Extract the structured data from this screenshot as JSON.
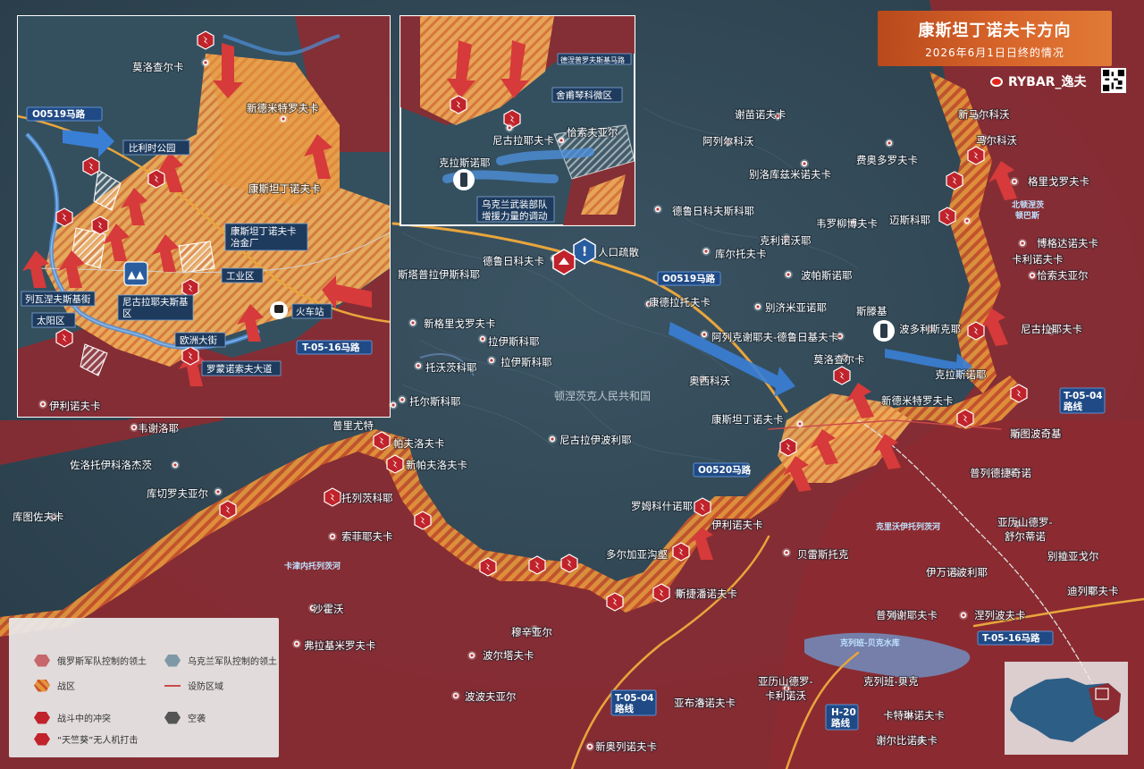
{
  "header": {
    "title": "康斯坦丁诺夫卡方向",
    "subtitle": "2026年6月1日日终的情况",
    "brand": "RYBAR_逸夫"
  },
  "colors": {
    "russian": "#8f2a30",
    "ukrainian": "#2f4f62",
    "combat_zone": "#e89a3a",
    "accent": "#d8652a",
    "road_label": "#1f4a86"
  },
  "legend": {
    "russian": "俄罗斯军队控制的领土",
    "ukrainian": "乌克兰军队控制的领土",
    "zone": "战区",
    "defense": "设防区域",
    "conflict": "战斗中的冲突",
    "airstrike": "空袭",
    "drone": "“天竺葵”无人机打击"
  },
  "inset_left": {
    "places": {
      "molochar": "莫洛查尔卡",
      "novodmitrovka": "新德米特罗夫卡",
      "bilytsk_park": "比利时公园",
      "konst": "康斯坦丁诺夫卡",
      "metallurgical": "康斯坦丁诺夫卡\n冶金厂",
      "industrial": "工业区",
      "leva": "列瓦涅夫斯基街",
      "nikolaev_district": "尼古拉耶夫斯基\n区",
      "sun": "太阳区",
      "europe_st": "欧洲大街",
      "rom": "罗蒙诺索夫大道",
      "station": "火车站",
      "ilinovka": "伊利诺夫卡"
    },
    "roads": {
      "o0519": "O0519马路",
      "t0516": "T-05-16马路"
    }
  },
  "inset_top": {
    "places": {
      "kramatorsk_plant": "德涅普罗夫斯基马路",
      "shevchenko": "舍甫琴科微区",
      "nikolaevka": "尼古拉耶夫卡",
      "chasov": "恰索夫亚尔",
      "kramat": "克拉斯诺耶",
      "reinforce": "乌克兰武装部队\n增援力量的调动"
    }
  },
  "main": {
    "places": {
      "stupochky": "斯塔普拉伊斯科耶",
      "dezh": "德鲁日科夫卡",
      "evac": "人口疏散",
      "o0519": "O0519马路",
      "konstrow": "康德拉托夫卡",
      "alek": "阿列克谢耶夫-德鲁日基夫卡",
      "oseva": "奥西科沃",
      "donbas": "顿涅茨克人民共和国",
      "konst": "康斯坦丁诺夫卡",
      "nikop": "尼古拉伊波利耶",
      "novgor": "新格里戈罗夫卡",
      "plas": "拉伊斯科耶",
      "tor": "托沃茨科耶",
      "torsk": "托尔斯科耶",
      "ksh": "拉伊斯科耶",
      "ivlev": "谢苗诺夫卡",
      "arch": "阿列尔科沃",
      "bel": "别洛库兹米诺夫卡",
      "fed": "费奥多罗夫卡",
      "druz": "德鲁日科夫斯科耶",
      "kras": "克利诺沃耶",
      "kurt": "库尔托夫卡",
      "vrub": "韦罗柳博夫卡",
      "pod": "波帕斯诺耶",
      "bili": "别济米亚诺耶",
      "stup": "斯滕基",
      "polis": "波多利斯克耶",
      "nikol": "尼古拉耶夫卡",
      "moloc": "莫洛查尔卡",
      "kram2": "克拉斯诺耶",
      "novdm": "新德米特罗夫卡",
      "minsk": "迈斯科耶",
      "novmar": "新马尔科沃",
      "mark": "马尔科沃",
      "gri": "格里戈罗夫卡",
      "don": "北顿涅茨\n顿巴斯",
      "bogo": "博格达诺夫卡",
      "kali": "卡利诺夫卡",
      "chas": "恰索夫亚尔",
      "t0504": "T-05-04\n路线",
      "stup2": "斯图波奇基",
      "prem": "普列德捷奇诺",
      "ale": "亚历山德罗-\n舒尔蒂诺",
      "bil": "别拉亚戈尔",
      "ivanop": "伊万诺波利耶",
      "diliev": "迪列耶夫卡",
      "pshel": "涅列波夫卡",
      "prib": "普列谢耶夫卡",
      "t0516": "T-05-16马路",
      "klh": "克列班-贝克水库",
      "kle": "克列班-贝克",
      "ale2": "亚历山德罗-\n卡利诺沃",
      "h20": "H-20\n路线",
      "kat": "卡特琳诺夫卡",
      "shch": "谢尔比诺夫卡",
      "belo": "贝雷斯托克",
      "step": "斯捷潘诺夫卡",
      "ilin": "伊利诺夫卡",
      "rom": "罗姆科什诺耶",
      "dol": "多尔加亚沟壑",
      "o0520": "O0520马路",
      "prib2": "普里尤特",
      "pav": "帕夫洛夫卡",
      "novpav": "新帕夫洛夫卡",
      "torl": "托列茨科耶",
      "sof": "索菲耶夫卡",
      "kurd": "库切罗夫亚尔",
      "kura": "库图佐夫卡",
      "zol": "佐洛托伊科洛杰茨",
      "vesh": "韦谢洛耶",
      "shakh": "沙霍沃",
      "vlad": "弗拉基米罗夫卡",
      "muss": "穆辛亚尔",
      "pol": "波尔塔夫卡",
      "pob": "波波夫亚尔",
      "alek3": "亚布洛诺夫卡",
      "novale": "新奥列诺夫卡",
      "t0504b": "T-05-04\n路线",
      "river1": "卡津内托列茨河",
      "river2": "克里沃伊托列茨河",
      "t0516b": "T-05-16马路",
      "t0504c": "T-05-04\n路线"
    }
  }
}
